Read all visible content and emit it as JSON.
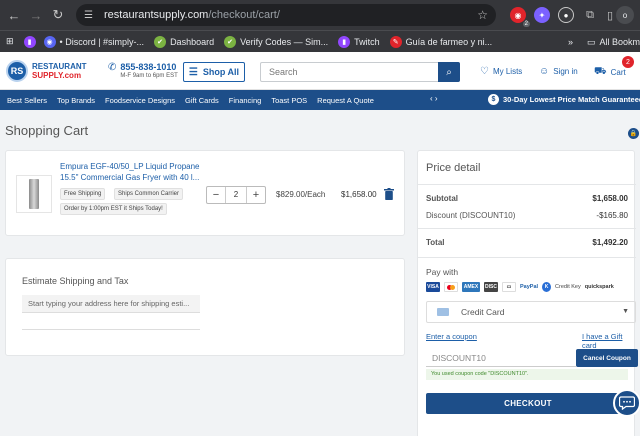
{
  "browser": {
    "url_host": "restaurantsupply.com",
    "url_path": "/checkout/cart/",
    "ext_badge": "2",
    "avatar_letter": "o",
    "bookmarks": [
      {
        "label": "• Discord | #simply-...",
        "color": "#5865f2",
        "glyph": "◉"
      },
      {
        "label": "Dashboard",
        "color": "#7cb342",
        "glyph": "✔"
      },
      {
        "label": "Verify Codes — Sim...",
        "color": "#7cb342",
        "glyph": "✔"
      },
      {
        "label": "Twitch",
        "color": "#9146ff",
        "glyph": "▮"
      },
      {
        "label": "Guía de farmeo y ni...",
        "color": "#e0242b",
        "glyph": "✎"
      }
    ],
    "bookmarks_overflow": "»",
    "all_bookmarks": "All Bookm"
  },
  "header": {
    "logo_mark": "RS",
    "logo_line1": "RESTAURANT",
    "logo_line2": "SUPPLY.com",
    "phone": "855-838-1010",
    "hours": "M-F 9am to 6pm EST",
    "shop_all": "Shop All",
    "search_placeholder": "Search",
    "my_lists": "My Lists",
    "sign_in": "Sign in",
    "cart": "Cart",
    "cart_count": "2"
  },
  "catnav": {
    "items": [
      "Best Sellers",
      "Top Brands",
      "Foodservice Designs",
      "Gift Cards",
      "Financing",
      "Toast POS",
      "Request A Quote"
    ],
    "arrows": "‹  ›",
    "banner": "30-Day Lowest Price Match Guaranteed"
  },
  "cart": {
    "title": "Shopping Cart",
    "item": {
      "name": "Empura EGF-40/50_LP Liquid Propane 15.5\" Commercial Gas Fryer with 40 l...",
      "tags": [
        "Free Shipping",
        "Ships Common Carrier",
        "Order by 1:00pm EST it Ships Today!"
      ],
      "qty": "2",
      "each": "$829.00/Each",
      "total": "$1,658.00"
    }
  },
  "shipping": {
    "title": "Estimate Shipping and Tax",
    "placeholder": "Start typing your address here for shipping esti..."
  },
  "summary": {
    "title": "Price detail",
    "subtotal_label": "Subtotal",
    "subtotal": "$1,658.00",
    "discount_label": "Discount (DISCOUNT10)",
    "discount": "-$165.80",
    "total_label": "Total",
    "total": "$1,492.20",
    "pay_with": "Pay with",
    "pay_methods": {
      "paypal": "PayPal",
      "credit_key": "Credit Key",
      "quickspark": "quickspark"
    },
    "payment_method": "Credit Card",
    "enter_coupon": "Enter a coupon",
    "gift_card": "I have a Gift card",
    "coupon_value": "DISCOUNT10",
    "cancel_coupon": "Cancel Coupon",
    "coupon_note": "You used coupon code \"DISCOUNT10\".",
    "checkout": "CHECKOUT"
  },
  "colors": {
    "brand": "#1d4e89",
    "accent_red": "#e0242b",
    "link": "#1d5fa8"
  }
}
